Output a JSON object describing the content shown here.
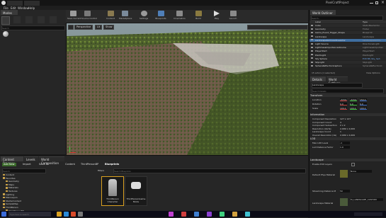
{
  "window": {
    "tab_title": "Landscape",
    "project_name": "PixelCraftProject"
  },
  "menu": [
    "File",
    "Edit",
    "Window",
    "Help"
  ],
  "modes": {
    "tab": "Modes",
    "search_placeholder": "Search"
  },
  "toolbar": {
    "buttons": [
      {
        "label": "Save Current",
        "icon": "save-icon",
        "color": "#9c9c9c"
      },
      {
        "label": "Source Control",
        "icon": "source-control-icon",
        "color": "#7a7a7a"
      },
      {
        "label": "Content",
        "icon": "content-icon",
        "color": "#8a7a50"
      },
      {
        "label": "Marketplace",
        "icon": "marketplace-icon",
        "color": "#7a8a9a"
      },
      {
        "label": "Settings",
        "icon": "gear-icon",
        "color": "#9a9a9a"
      },
      {
        "label": "Blueprints",
        "icon": "blueprint-icon",
        "color": "#4f7fb8"
      },
      {
        "label": "Cinematics",
        "icon": "cinematics-icon",
        "color": "#8a8a8a"
      },
      {
        "label": "Build",
        "icon": "build-icon",
        "color": "#8a7a40"
      },
      {
        "label": "Play",
        "icon": "play-icon",
        "color": "#dddddd"
      },
      {
        "label": "Launch",
        "icon": "launch-icon",
        "color": "#8a8a8a"
      }
    ]
  },
  "viewport": {
    "perspective": "Perspective",
    "lit": "Lit",
    "show": "Show"
  },
  "outliner": {
    "tab": "World Outliner",
    "search_placeholder": "Search...",
    "col_label": "Label",
    "col_type": "Type",
    "rows": [
      {
        "label": "Cube",
        "type": "StaticMeshActor",
        "selected": false
      },
      {
        "label": "Geometry",
        "type": "Folder",
        "selected": false
      },
      {
        "label": "Game_Event_Trigger_Shape",
        "type": "Blueprint",
        "selected": false
      },
      {
        "label": "Landscape",
        "type": "Landscape",
        "selected": false
      },
      {
        "label": "LandscapeGizmoActiveActor",
        "type": "LandscapeGizmo",
        "selected": true
      },
      {
        "label": "Light Source",
        "type": "DirectionalLight",
        "selected": false
      },
      {
        "label": "LightmassImportanceVolume",
        "type": "LightmassImportan",
        "selected": false
      },
      {
        "label": "PlayerStart",
        "type": "PlayerStart",
        "selected": false
      },
      {
        "label": "PointLight",
        "type": "PointLight",
        "selected": false
      },
      {
        "label": "Sky Sphere",
        "type": "Edit BP_Sky_Sph",
        "selected": false
      },
      {
        "label": "SkyLight",
        "type": "SkyLight",
        "selected": false
      },
      {
        "label": "SphereReflectionCapture",
        "type": "SphereReflectionC",
        "selected": false
      }
    ],
    "footer_count": "15 actors (1 selected)",
    "view_options": "View Options"
  },
  "details": {
    "tab_details": "Details",
    "tab_world_settings": "World Settings",
    "actor_name": "Landscape",
    "search_placeholder": "Search Details",
    "sections": {
      "transform": "Transform",
      "information": "Information",
      "lod": "LOD",
      "landscape": "Landscape"
    },
    "transform": [
      {
        "label": "Location",
        "x": "-3150.0",
        "y": "-3150.0",
        "z": "150.0"
      },
      {
        "label": "Rotation",
        "x": "0.0",
        "y": "0.0",
        "z": "0.0"
      },
      {
        "label": "Scale",
        "x": "100.0",
        "y": "100.0",
        "z": "100.0"
      }
    ],
    "info": [
      {
        "label": "Component Resolution",
        "value": "127 x 127"
      },
      {
        "label": "Component Count",
        "value": "4"
      },
      {
        "label": "Component Subsection",
        "value": "2 x 2"
      },
      {
        "label": "Resolution (Verts)",
        "value": "2,009 x 2,009"
      },
      {
        "label": "Landscape Count",
        "value": "1"
      },
      {
        "label": "Overall Resolution (Ve)",
        "value": "2,009 x 2,009"
      }
    ],
    "lod": [
      {
        "label": "Max LOD Level",
        "value": "-1"
      },
      {
        "label": "Lod Distance Factor",
        "value": "1.0"
      }
    ],
    "landscape_props": [
      {
        "label": "Enable Edit Layers",
        "value": ""
      },
      {
        "label": "Default Phys Material",
        "value": "None"
      },
      {
        "label": "Streaming Distance M",
        "value": "50"
      },
      {
        "label": "Landscape Material",
        "value": "M_LANDSCAPE_CUSTOM"
      }
    ]
  },
  "content_browser": {
    "tabs": [
      "Content Browser",
      "Levels",
      "World Composition"
    ],
    "add_new": "Add New",
    "import": "Import",
    "save_all": "Save All",
    "path": [
      "Content",
      "ThirdPersonBP",
      "Blueprints"
    ],
    "search_placeholder": "Search Blueprints",
    "filters": "Filters",
    "tree": [
      "Content",
      "Favorites",
      "Geometry",
      "Maps",
      "Materials",
      "Textures",
      "Lighting",
      "Mannequin",
      "StarterContent",
      "SampleMap",
      "ThirdPerson",
      "ThirdPersonBP"
    ],
    "assets": [
      {
        "name": "ThirdPerson Character",
        "type": "Blueprint"
      },
      {
        "name": "ThirdPersonGame Mode",
        "type": "Blueprint"
      }
    ],
    "item_count": "2 items (1 selected)",
    "view_options": "View Options"
  },
  "taskbar": {
    "search_placeholder": "Type here to search"
  }
}
